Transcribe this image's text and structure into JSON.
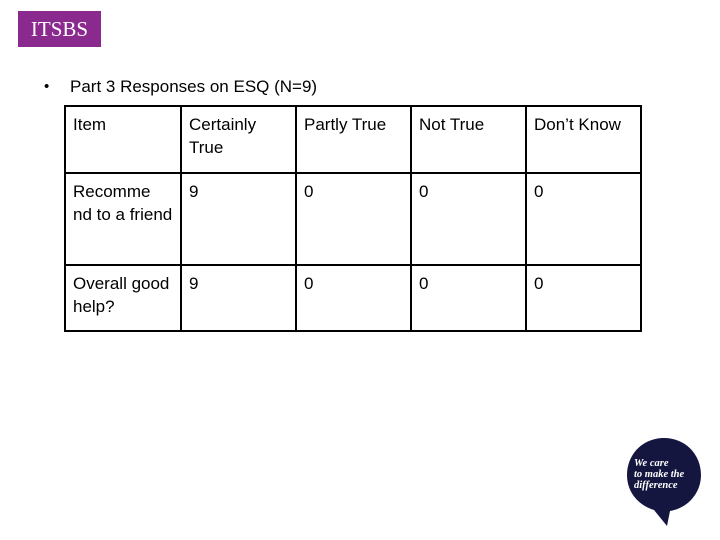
{
  "header": {
    "badge_text": "ITSBS",
    "badge_color": "#8b2a8e"
  },
  "bullet": {
    "symbol": "•",
    "text": "Part 3 Responses on ESQ (N=9)"
  },
  "table": {
    "columns": [
      "Item",
      "Certainly True",
      "Partly True",
      "Not True",
      "Don’t Know"
    ],
    "rows": [
      {
        "item": "Recommend to a friend",
        "item_display": "Recomme nd to a friend",
        "values": [
          "9",
          "0",
          "0",
          "0"
        ]
      },
      {
        "item": "Overall good help?",
        "item_display": "Overall good help?",
        "values": [
          "9",
          "0",
          "0",
          "0"
        ]
      }
    ]
  },
  "logo": {
    "lines": [
      "We care",
      "to make the",
      "difference"
    ],
    "color": "#14163f"
  }
}
